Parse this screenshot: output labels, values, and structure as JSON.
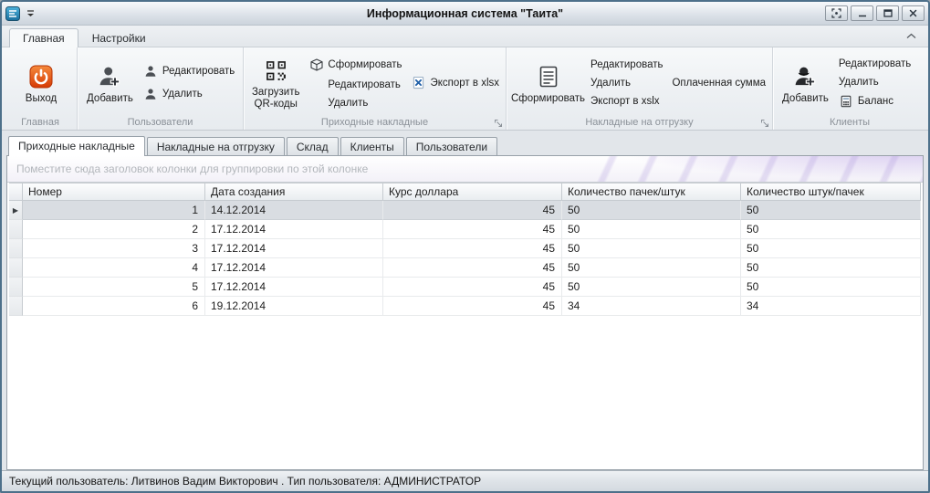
{
  "window": {
    "title": "Информационная система \"Таита\""
  },
  "colors": {
    "power_icon": "#e8541f",
    "export_icon": "#1f5fa8",
    "app_icon": "#1a6f9e"
  },
  "ribbon": {
    "tabs": {
      "home": "Главная",
      "settings": "Настройки"
    },
    "home_group": {
      "caption": "Главная",
      "exit": "Выход"
    },
    "users_group": {
      "caption": "Пользователи",
      "add": "Добавить",
      "edit": "Редактировать",
      "remove": "Удалить"
    },
    "incoming_group": {
      "caption": "Приходные накладные",
      "load_qr": "Загрузить QR-коды",
      "generate": "Сформировать",
      "edit": "Редактировать",
      "remove": "Удалить",
      "export": "Экспорт в xlsx"
    },
    "shipping_group": {
      "caption": "Накладные на отгрузку",
      "generate": "Сформировать",
      "edit": "Редактировать",
      "remove": "Удалить",
      "export": "Экспорт в xslx",
      "paid_sum": "Оплаченная сумма"
    },
    "clients_group": {
      "caption": "Клиенты",
      "add": "Добавить",
      "edit": "Редактировать",
      "remove": "Удалить",
      "balance": "Баланс"
    }
  },
  "doc_tabs": {
    "incoming": "Приходные накладные",
    "shipping": "Накладные на отгрузку",
    "warehouse": "Склад",
    "clients": "Клиенты",
    "users": "Пользователи"
  },
  "grid": {
    "group_panel_hint": "Поместите сюда заголовок колонки для группировки по этой колонке",
    "columns": [
      "Номер",
      "Дата создания",
      "Курс доллара",
      "Количество пачек/штук",
      "Количество штук/пачек"
    ],
    "rows": [
      [
        "1",
        "14.12.2014",
        "45",
        "50",
        "50"
      ],
      [
        "2",
        "17.12.2014",
        "45",
        "50",
        "50"
      ],
      [
        "3",
        "17.12.2014",
        "45",
        "50",
        "50"
      ],
      [
        "4",
        "17.12.2014",
        "45",
        "50",
        "50"
      ],
      [
        "5",
        "17.12.2014",
        "45",
        "50",
        "50"
      ],
      [
        "6",
        "19.12.2014",
        "45",
        "34",
        "34"
      ]
    ],
    "selected_index": 0
  },
  "status_bar": {
    "text": "Текущий пользователь: Литвинов Вадим Викторович . Тип пользователя: АДМИНИСТРАТОР"
  }
}
